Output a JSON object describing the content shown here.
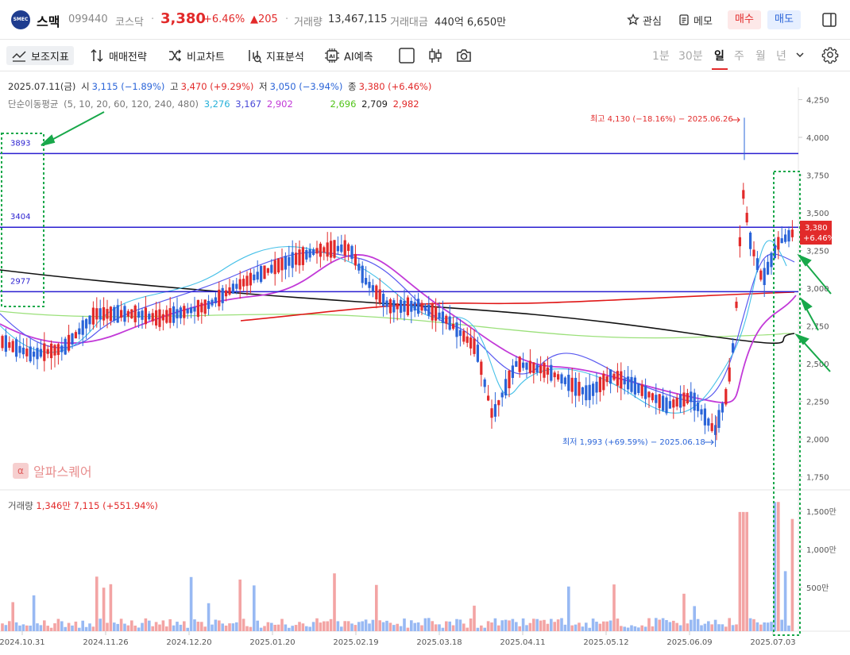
{
  "header": {
    "logo_text": "SMEC",
    "name": "스맥",
    "code": "099440",
    "market": "코스닥",
    "separator": "·",
    "price": "3,380",
    "change_rate": "+6.46%",
    "change": "▲205",
    "volume_label": "거래량",
    "volume": "13,467,115",
    "amount_label": "거래대금",
    "amount": "440억 6,650만",
    "favorite_label": "관심",
    "memo_label": "메모",
    "buy_label": "매수",
    "sell_label": "매도"
  },
  "toolbar": {
    "indicator_label": "보조지표",
    "strategy_label": "매매전략",
    "compare_label": "비교차트",
    "analysis_label": "지표분석",
    "ai_label": "AI예측",
    "periods": [
      "1분",
      "30분",
      "일",
      "주",
      "월",
      "년"
    ],
    "selected_period": "일"
  },
  "info": {
    "date": "2025.07.11(금)",
    "open_label": "시",
    "open": "3,115 (−1.89%)",
    "high_label": "고",
    "high": "3,470 (+9.29%)",
    "low_label": "저",
    "low": "3,050 (−3.94%)",
    "close_label": "종",
    "close": "3,380 (+6.46%)",
    "ma_label": "단순이동평균",
    "ma_params": "(5, 10, 20, 60, 120, 240, 480)",
    "ma_values": [
      "3,276",
      "3,167",
      "2,902",
      "2,696",
      "2,709",
      "2,982"
    ]
  },
  "annotations": {
    "high": "최고 4,130 (−18.16%) − 2025.06.26",
    "low": "최저 1,993 (+69.59%) − 2025.06.18",
    "line_3893": "3893",
    "line_3404": "3404",
    "line_2977": "2977",
    "price_tag": "3,380",
    "price_tag_rate": "+6.46%"
  },
  "watermark": {
    "icon": "α",
    "text": "알파스퀘어"
  },
  "volume_info": {
    "label": "거래량",
    "value": "1,346만 7,115 (+551.94%)"
  },
  "chart_data": {
    "type": "candlestick",
    "price_axis": {
      "ticks": [
        "4,250",
        "4,000",
        "3,750",
        "3,500",
        "3,250",
        "3,000",
        "2,750",
        "2,500",
        "2,250",
        "2,000",
        "1,750"
      ],
      "ylim": [
        1700,
        4320
      ]
    },
    "volume_axis": {
      "ticks": [
        "1,500만",
        "1,000만",
        "500만"
      ]
    },
    "x_ticks": [
      "2024.10.31",
      "2024.11.26",
      "2024.12.20",
      "2025.01.20",
      "2025.02.19",
      "2025.03.18",
      "2025.04.11",
      "2025.05.12",
      "2025.06.09",
      "2025.07.03"
    ],
    "horizontal_lines": [
      3893,
      3404,
      2977
    ],
    "last_close": 3380,
    "high": {
      "value": 4130,
      "date": "2025.06.26"
    },
    "low": {
      "value": 1993,
      "date": "2025.06.18"
    },
    "colors": {
      "up": "#e22a2a",
      "down": "#2a64d8",
      "hline": "#2a1fd0",
      "annotation_box": "#18a84a"
    }
  }
}
